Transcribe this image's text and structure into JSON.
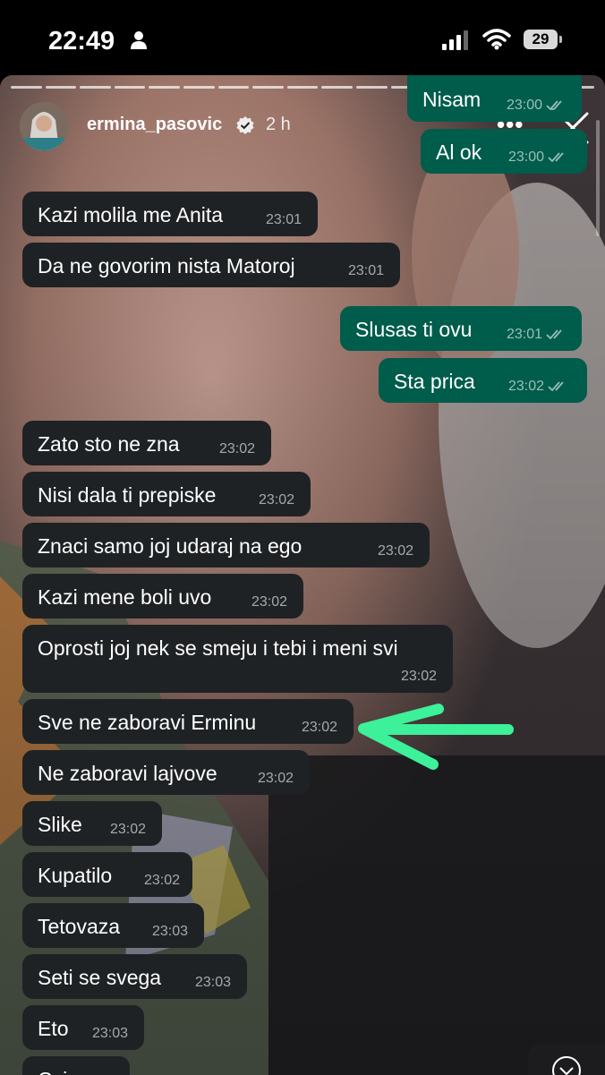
{
  "status": {
    "time": "22:49",
    "battery": "29"
  },
  "story": {
    "username": "ermina_pasovic",
    "age": "2 h",
    "more": "•••",
    "segments": 17
  },
  "messages": {
    "m0": {
      "text": "Nisam",
      "time": "23:00"
    },
    "m1": {
      "text": "Al ok",
      "time": "23:00"
    },
    "m2": {
      "text": "Kazi molila me Anita",
      "time": "23:01"
    },
    "m3": {
      "text": "Da ne govorim nista Matoroj",
      "time": "23:01"
    },
    "m4": {
      "text": "Slusas ti ovu",
      "time": "23:01"
    },
    "m5": {
      "text": "Sta prica",
      "time": "23:02"
    },
    "m6": {
      "text": "Zato sto ne zna",
      "time": "23:02"
    },
    "m7": {
      "text": "Nisi dala ti prepiske",
      "time": "23:02"
    },
    "m8": {
      "text": "Znaci samo joj udaraj na ego",
      "time": "23:02"
    },
    "m9": {
      "text": "Kazi mene boli uvo",
      "time": "23:02"
    },
    "m10": {
      "text": "Oprosti joj nek se smeju i tebi i meni svi",
      "time": "23:02"
    },
    "m11": {
      "text": "Sve ne zaboravi Erminu",
      "time": "23:02"
    },
    "m12": {
      "text": "Ne zaboravi lajvove",
      "time": "23:02"
    },
    "m13": {
      "text": "Slike",
      "time": "23:02"
    },
    "m14": {
      "text": "Kupatilo",
      "time": "23:02"
    },
    "m15": {
      "text": "Tetovaza",
      "time": "23:03"
    },
    "m16": {
      "text": "Seti se svega",
      "time": "23:03"
    },
    "m17": {
      "text": "Eto",
      "time": "23:03"
    },
    "m18": {
      "text": "Cvica",
      "time": ""
    }
  },
  "colors": {
    "incoming_bubble": "#1f2224",
    "outgoing_bubble": "#005c4b",
    "annotation_arrow": "#3df09a"
  },
  "icons": [
    "person-icon",
    "signal-icon",
    "wifi-icon",
    "verified-icon",
    "close-icon",
    "double-check-icon",
    "chevron-down-icon"
  ]
}
